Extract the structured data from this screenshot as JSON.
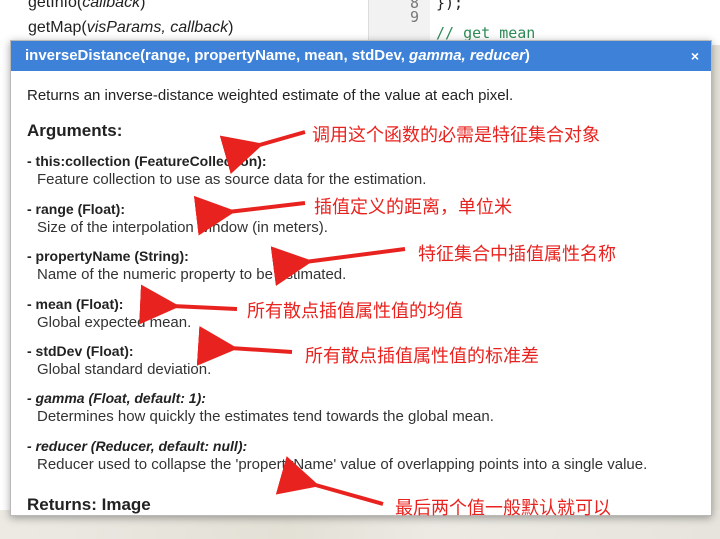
{
  "background": {
    "methods": [
      {
        "name": "getInfo(",
        "param": "callback",
        "close": ")"
      },
      {
        "name": "getMap(",
        "param": "visParams, callback",
        "close": ")"
      }
    ],
    "line_numbers": [
      "8",
      "9"
    ],
    "code_lines": [
      "});",
      "// get mean"
    ]
  },
  "popup": {
    "title_plain": "inverseDistance(range, propertyName, mean, stdDev, ",
    "title_optional": "gamma, reducer",
    "title_close": ")",
    "close_label": "×",
    "description": "Returns an inverse-distance weighted estimate of the value at each pixel.",
    "arguments_heading": "Arguments:",
    "arguments": [
      {
        "name": "- this:collection (FeatureCollection):",
        "desc": "Feature collection to use as source data for the estimation.",
        "optional": false
      },
      {
        "name": "- range (Float):",
        "desc": "Size of the interpolation window (in meters).",
        "optional": false
      },
      {
        "name": "- propertyName (String):",
        "desc": "Name of the numeric property to be estimated.",
        "optional": false
      },
      {
        "name": "- mean (Float):",
        "desc": "Global expected mean.",
        "optional": false
      },
      {
        "name": "- stdDev (Float):",
        "desc": "Global standard deviation.",
        "optional": false
      },
      {
        "name": "- gamma (Float, default: 1):",
        "desc": "Determines how quickly the estimates tend towards the global mean.",
        "optional": true
      },
      {
        "name": "- reducer (Reducer, default: null):",
        "desc": "Reducer used to collapse the 'propertyName' value of overlapping points into a single value.",
        "optional": true
      }
    ],
    "returns_heading": "Returns: Image"
  },
  "annotations": [
    "调用这个函数的必需是特征集合对象",
    "插值定义的距离，单位米",
    "特征集合中插值属性名称",
    "所有散点插值属性值的均值",
    "所有散点插值属性值的标准差",
    "最后两个值一般默认就可以"
  ],
  "colors": {
    "header": "#3d82d8",
    "annotation": "#e8231f",
    "comment": "#2e8b57"
  }
}
